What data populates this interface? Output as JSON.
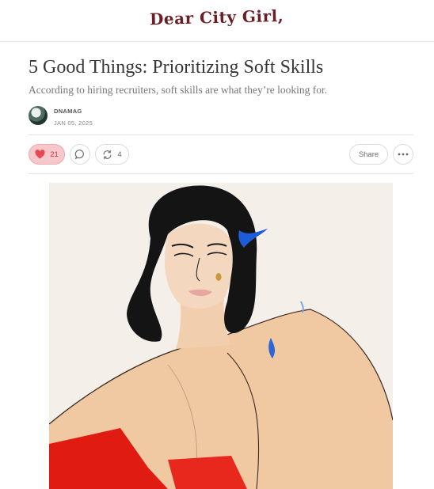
{
  "site": {
    "logo": "Dear City Girl,"
  },
  "article": {
    "title": "5 Good Things: Prioritizing Soft Skills",
    "subtitle": "According to hiring recruiters, soft skills are what they’re looking for.",
    "author": "DNAMAG",
    "date": "JAN 05, 2025"
  },
  "actions": {
    "likes": "21",
    "restacks": "4",
    "share_label": "Share"
  },
  "icons": {
    "like": "heart-icon",
    "comment": "comment-bubble-icon",
    "restack": "restack-icon",
    "more": "more-dots-icon"
  },
  "colors": {
    "accent_like": "#e8484f",
    "liked_bg": "#f6c8cb",
    "logo": "#6b1f25"
  }
}
